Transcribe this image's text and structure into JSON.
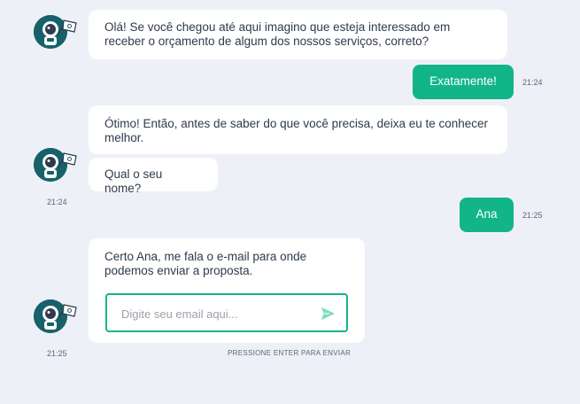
{
  "chat": {
    "bot_msg_1": "Olá! Se você chegou até aqui imagino que esteja interessado em receber o orçamento de algum dos nossos serviços, correto?",
    "user_msg_1": "Exatamente!",
    "user_time_1": "21:24",
    "bot_msg_2": "Ótimo! Então, antes de saber do que você precisa, deixa eu te conhecer melhor.",
    "bot_msg_3": "Qual o seu nome?",
    "bot_time_2": "21:24",
    "user_msg_2": "Ana",
    "user_time_2": "21:25",
    "bot_msg_4": "Certo Ana, me fala o e-mail para onde podemos enviar a proposta.",
    "bot_time_3": "21:25"
  },
  "email_input": {
    "placeholder": "Digite seu email aqui...",
    "value": ""
  },
  "hint": "PRESSIONE ENTER PARA ENVIAR",
  "icons": {
    "avatar": "astronaut-avatar-icon",
    "send": "send-icon"
  },
  "colors": {
    "accent": "#12b588",
    "avatar_bg": "#17626a",
    "background": "#eef0f7"
  }
}
